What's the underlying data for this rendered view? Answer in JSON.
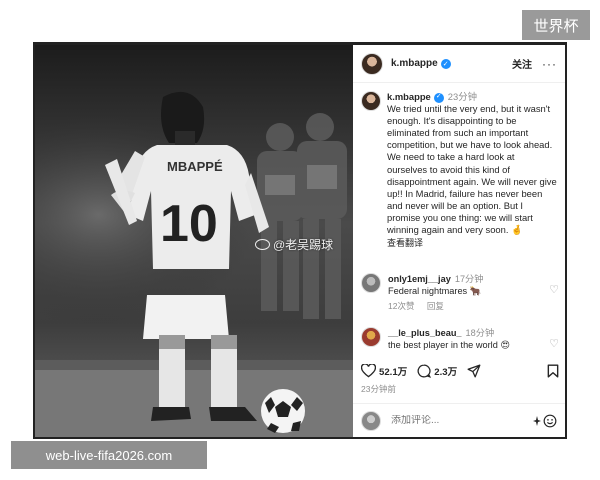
{
  "corner_tag": "世界杯",
  "watermark": {
    "weibo": "@老吴踢球"
  },
  "photo": {
    "jersey_name": "MBAPPÉ",
    "jersey_number": "10"
  },
  "profile": {
    "username": "k.mbappe",
    "follow_label": "关注",
    "more_icon": "more-horizontal-icon"
  },
  "caption": {
    "username": "k.mbappe",
    "time": "23分钟",
    "text": "We tried until the very end, but it wasn't enough. It's disappointing to be eliminated from such an important competition, but we have to look ahead. We need to take a hard look at ourselves to avoid this kind of disappointment again. We will never give up!! In Madrid, failure has never been and never will be an option. But I promise you one thing: we will start winning again and very soon. 🤞",
    "translate": "查看翻译"
  },
  "comments": [
    {
      "username": "only1emj__jay",
      "time": "17分钟",
      "text": "Federal nightmares 🐂",
      "likes": "12次赞",
      "reply": "回复"
    },
    {
      "username": "__le_plus_beau_",
      "time": "18分钟",
      "text": "the best player in the world 😍"
    }
  ],
  "actions": {
    "likes": "52.1万",
    "comments": "2.3万"
  },
  "post_time": "23分钟前",
  "comment_placeholder": "添加评论...",
  "site_tag": "web-live-fifa2026.com",
  "colors": {
    "verified": "#1e90ff",
    "tag_gray": "#8f8f8f"
  }
}
